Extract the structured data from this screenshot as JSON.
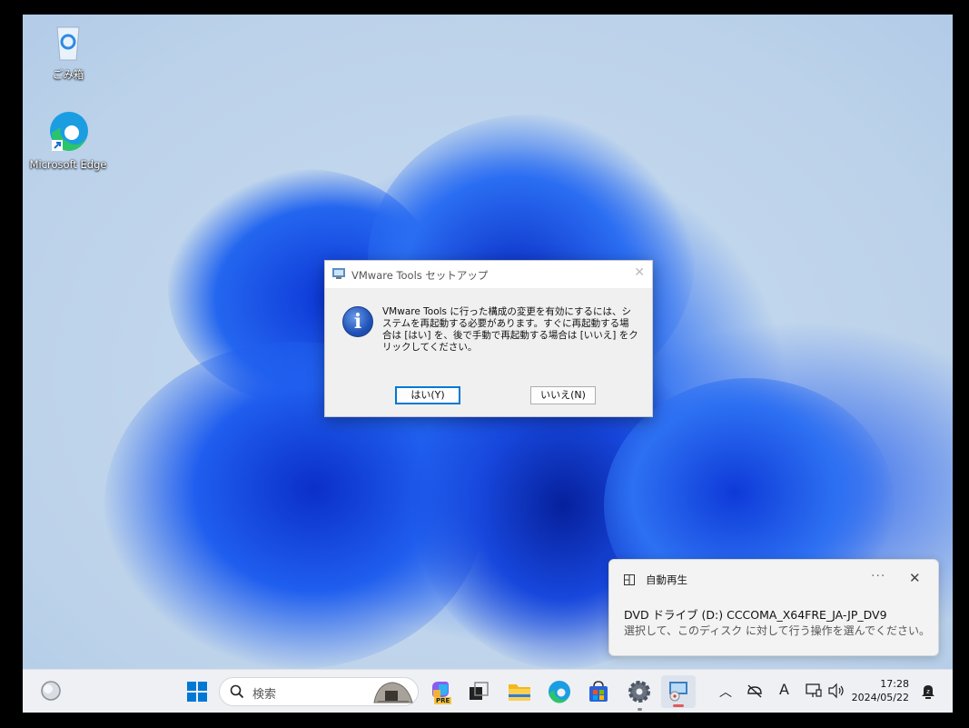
{
  "desktop": {
    "icons": [
      {
        "label": "ごみ箱",
        "icon": "recycle-bin-icon"
      },
      {
        "label": "Microsoft Edge",
        "icon": "edge-icon"
      }
    ]
  },
  "dialog": {
    "title": "VMware Tools セットアップ",
    "message": "VMware Tools に行った構成の変更を有効にするには、システムを再起動する必要があります。すぐに再起動する場合は [はい] を、後で手動で再起動する場合は [いいえ] をクリックしてください。",
    "yes_label": "はい(Y)",
    "no_label": "いいえ(N)",
    "icon": "info-icon"
  },
  "notification": {
    "app": "自動再生",
    "heading": "DVD ドライブ (D:) CCCOMA_X64FRE_JA-JP_DV9",
    "body": "選択して、このディスク に対して行う操作を選んでください。",
    "more": "···",
    "close": "✕"
  },
  "taskbar": {
    "search_placeholder": "検索",
    "pre_badge": "PRE",
    "pinned": [
      "start-icon",
      "search-icon",
      "copilot-icon",
      "task-view-icon",
      "file-explorer-icon",
      "edge-icon",
      "store-icon",
      "settings-icon",
      "vmware-tools-icon"
    ],
    "tray": {
      "chevron": "︿",
      "ime": "A",
      "time": "17:28",
      "date": "2024/05/22"
    }
  },
  "colors": {
    "accent": "#0078d4",
    "taskbar": "#eef0f4",
    "dialog": "#f0f0f0"
  }
}
